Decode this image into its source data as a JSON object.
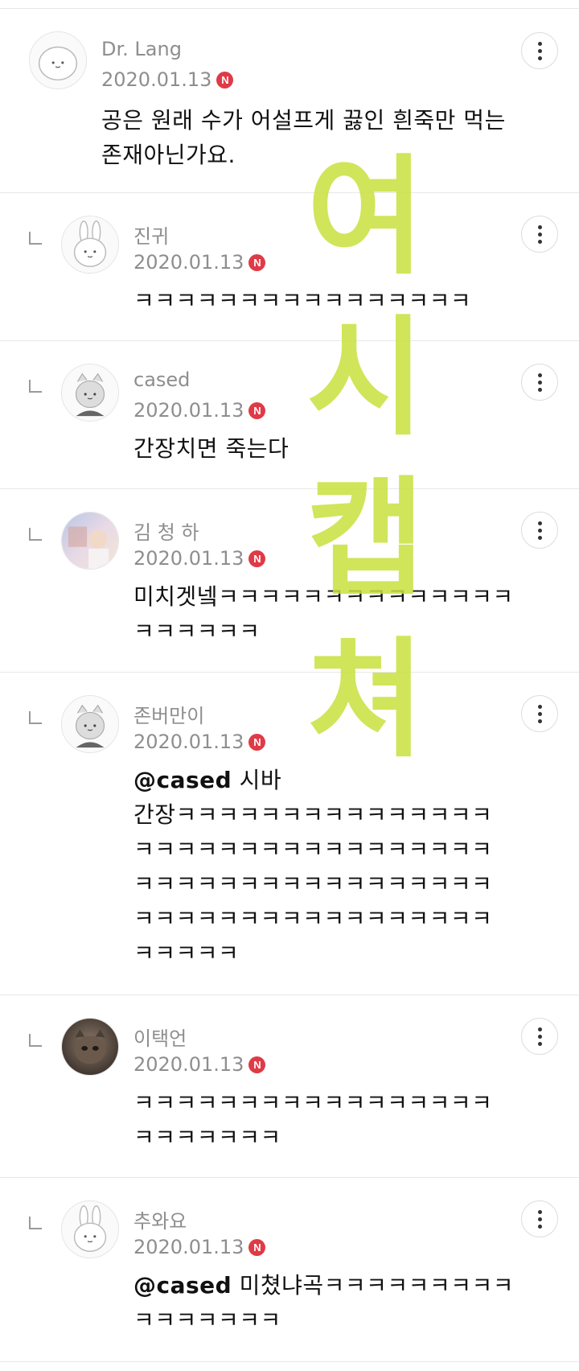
{
  "comments": [
    {
      "name": "Dr. Lang",
      "date": "2020.01.13",
      "badge": "N",
      "avatar": "bear-avatar",
      "reply": false,
      "lines": [
        "공은 원래 수가 어설프게 끓인 흰죽만 먹는",
        "존재아닌가요."
      ]
    },
    {
      "name": "진귀",
      "date": "2020.01.13",
      "badge": "N",
      "avatar": "rabbit-avatar",
      "reply": true,
      "lines": [
        "ㅋㅋㅋㅋㅋㅋㅋㅋㅋㅋㅋㅋㅋㅋㅋㅋ"
      ]
    },
    {
      "name": "cased",
      "date": "2020.01.13",
      "badge": "N",
      "avatar": "cat-avatar",
      "reply": true,
      "lines": [
        "간장치면 죽는다"
      ]
    },
    {
      "name": "김 청 하",
      "date": "2020.01.13",
      "badge": "N",
      "avatar": "photo-avatar",
      "reply": true,
      "lines": [
        "미치겟넼ㅋㅋㅋㅋㅋㅋㅋㅋㅋㅋㅋㅋㅋㅋ",
        "ㅋㅋㅋㅋㅋㅋ"
      ]
    },
    {
      "name": "존버만이",
      "date": "2020.01.13",
      "badge": "N",
      "avatar": "cat-avatar",
      "reply": true,
      "mention": "@cased",
      "lines": [
        " 시바",
        "간장ㅋㅋㅋㅋㅋㅋㅋㅋㅋㅋㅋㅋㅋㅋㅋ",
        "ㅋㅋㅋㅋㅋㅋㅋㅋㅋㅋㅋㅋㅋㅋㅋㅋㅋ",
        "ㅋㅋㅋㅋㅋㅋㅋㅋㅋㅋㅋㅋㅋㅋㅋㅋㅋ",
        "ㅋㅋㅋㅋㅋㅋㅋㅋㅋㅋㅋㅋㅋㅋㅋㅋㅋ",
        "ㅋㅋㅋㅋㅋ"
      ]
    },
    {
      "name": "이택언",
      "date": "2020.01.13",
      "badge": "N",
      "avatar": "cat-photo-avatar",
      "reply": true,
      "lines": [
        "ㅋㅋㅋㅋㅋㅋㅋㅋㅋㅋㅋㅋㅋㅋㅋㅋㅋ",
        "ㅋㅋㅋㅋㅋㅋㅋ"
      ]
    },
    {
      "name": "추와요",
      "date": "2020.01.13",
      "badge": "N",
      "avatar": "rabbit-avatar",
      "reply": true,
      "mention": "@cased",
      "lines": [
        " 미쳤냐곡ㅋㅋㅋㅋㅋㅋㅋㅋㅋ",
        "ㅋㅋㅋㅋㅋㅋㅋ"
      ]
    }
  ],
  "watermark": [
    "여",
    "시",
    "캡",
    "쳐"
  ],
  "colors": {
    "badge": "#e03a47",
    "watermark": "#c8e13c",
    "meta_text": "#8e8e8e"
  }
}
